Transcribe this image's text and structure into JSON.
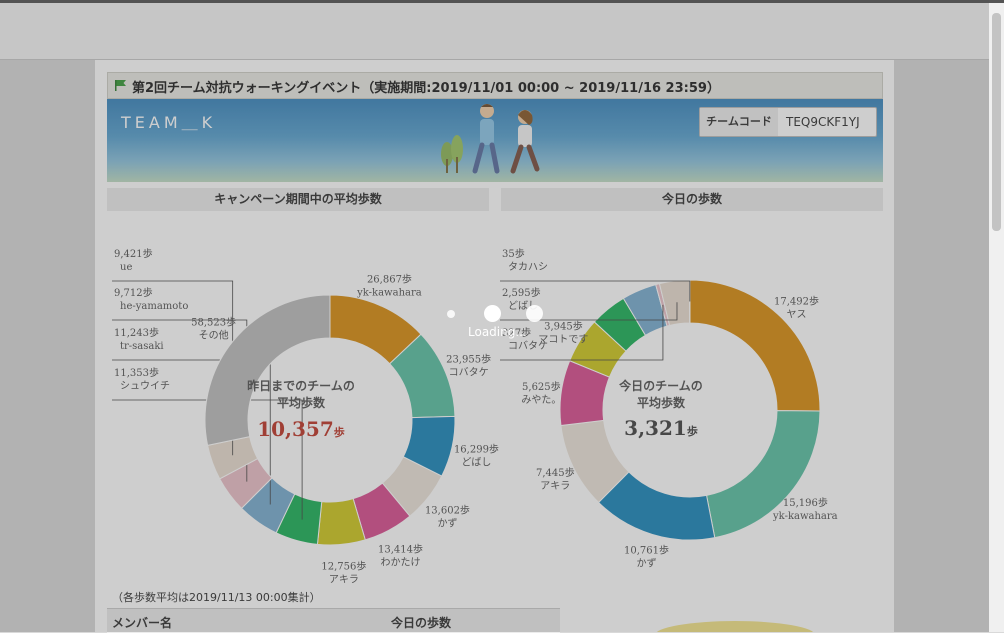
{
  "event": {
    "title": "第2回チーム対抗ウォーキングイベント（実施期間:2019/11/01 00:00 ~ 2019/11/16 23:59）",
    "team_name": "TEAM＿K",
    "team_code_label": "チームコード",
    "team_code": "TEQ9CKF1YJ"
  },
  "sections": {
    "left_title": "キャンペーン期間中の平均歩数",
    "right_title": "今日の歩数"
  },
  "colors": {
    "accent_red": "#c0392b",
    "segments": [
      "#d98e12",
      "#5cc1a4",
      "#1e88bb",
      "#ece4da",
      "#d94f90",
      "#cfc822",
      "#1fb25a",
      "#7aaed0",
      "#ebc0c8",
      "#e9ddd0",
      "#bdbdbd"
    ]
  },
  "chart_data": [
    {
      "type": "pie",
      "title": "キャンペーン期間中の平均歩数",
      "center_label_line1": "昨日までのチームの",
      "center_label_line2": "平均歩数",
      "center_value": "10,357",
      "center_unit": "歩",
      "slices": [
        {
          "name": "yk-kawahara",
          "value": 26867,
          "label": "26,867歩"
        },
        {
          "name": "コバタケ",
          "value": 23955,
          "label": "23,955歩"
        },
        {
          "name": "どばし",
          "value": 16299,
          "label": "16,299歩"
        },
        {
          "name": "かず",
          "value": 13602,
          "label": "13,602歩"
        },
        {
          "name": "わかたけ",
          "value": 13414,
          "label": "13,414歩"
        },
        {
          "name": "アキラ",
          "value": 12756,
          "label": "12,756歩"
        },
        {
          "name": "シュウイチ",
          "value": 11353,
          "label": "11,353歩"
        },
        {
          "name": "tr-sasaki",
          "value": 11243,
          "label": "11,243歩"
        },
        {
          "name": "he-yamamoto",
          "value": 9712,
          "label": "9,712歩"
        },
        {
          "name": "ue",
          "value": 9421,
          "label": "9,421歩"
        },
        {
          "name": "その他",
          "value": 58523,
          "label": "58,523歩"
        }
      ]
    },
    {
      "type": "pie",
      "title": "今日の歩数",
      "center_label_line1": "今日のチームの",
      "center_label_line2": "平均歩数",
      "center_value": "3,321",
      "center_unit": "歩",
      "slices": [
        {
          "name": "ヤス",
          "value": 17492,
          "label": "17,492歩"
        },
        {
          "name": "yk-kawahara",
          "value": 15196,
          "label": "15,196歩"
        },
        {
          "name": "かず",
          "value": 10761,
          "label": "10,761歩"
        },
        {
          "name": "アキラ",
          "value": 7445,
          "label": "7,445歩"
        },
        {
          "name": "みやた。",
          "value": 5625,
          "label": "5,625歩"
        },
        {
          "name": "マコトです",
          "value": 3945,
          "label": "3,945歩"
        },
        {
          "name": "",
          "value": 3200,
          "label": ""
        },
        {
          "name": "",
          "value": 3000,
          "label": ""
        },
        {
          "name": "コバタケ",
          "value": 327,
          "label": "327歩"
        },
        {
          "name": "どばし",
          "value": 2595,
          "label": "2,595歩"
        },
        {
          "name": "タカハシ",
          "value": 35,
          "label": "35歩"
        }
      ]
    }
  ],
  "footer": {
    "note": "（各歩数平均は2019/11/13 00:00集計）",
    "col_member": "メンバー名",
    "col_today": "今日の歩数"
  },
  "loading_text": "Loading..."
}
